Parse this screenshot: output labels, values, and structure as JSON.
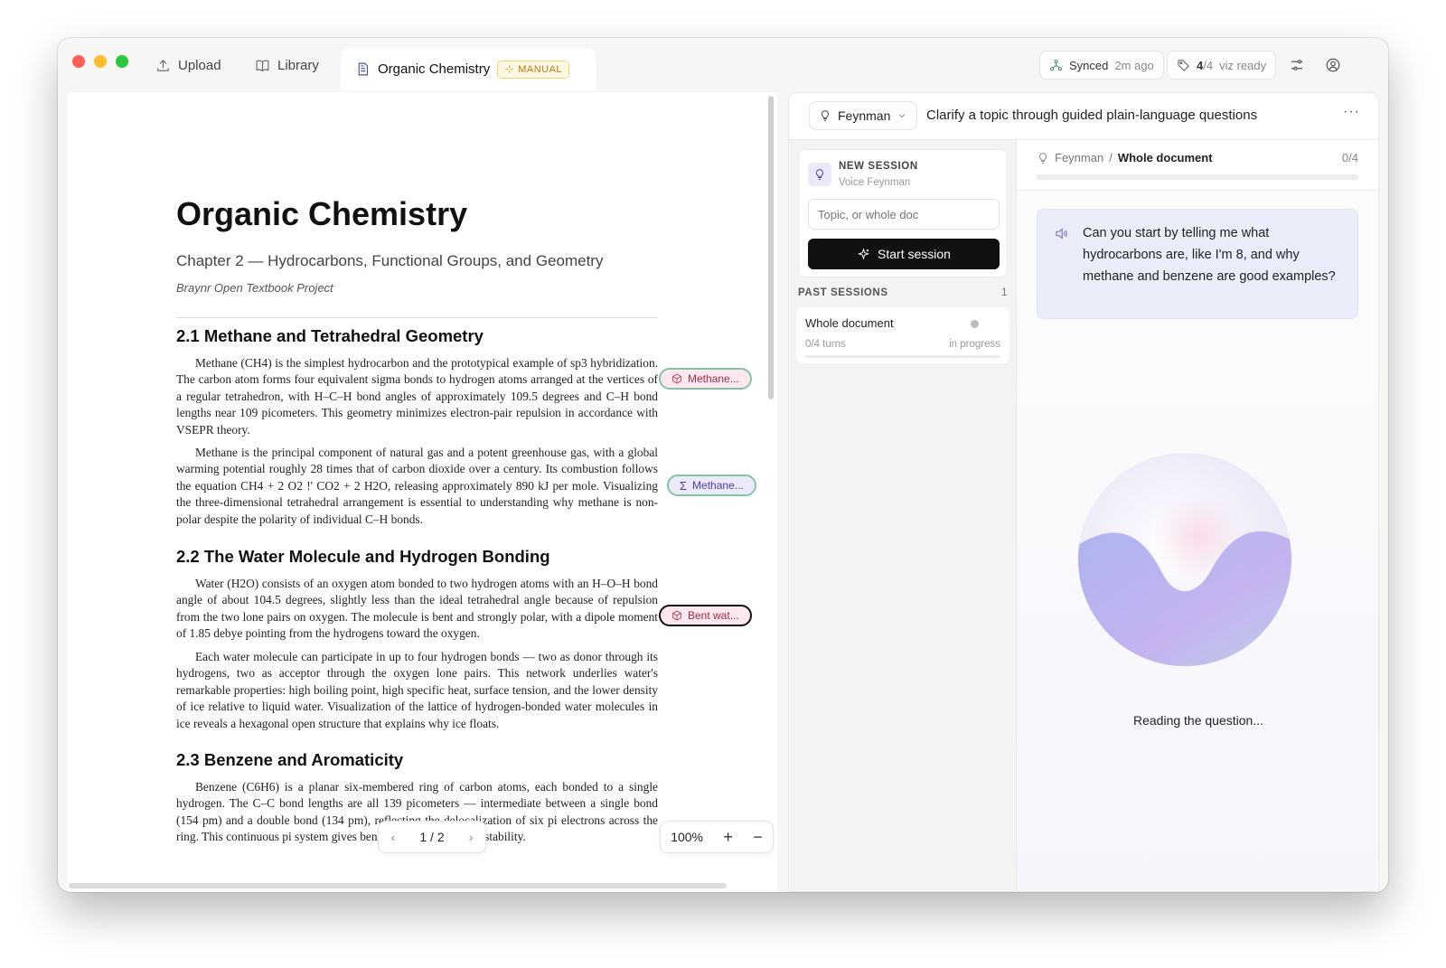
{
  "tabs": {
    "upload": "Upload",
    "library": "Library",
    "active": "Organic Chemistry",
    "active_badge": "MANUAL"
  },
  "status": {
    "sync_label": "Synced",
    "sync_time": "2m ago",
    "viz_count": "4",
    "viz_total": "/4",
    "viz_label": "viz ready"
  },
  "document": {
    "title": "Organic Chemistry",
    "chapter": "Chapter 2 — Hydrocarbons, Functional Groups, and Geometry",
    "publisher": "Braynr Open Textbook Project",
    "sections": [
      {
        "heading": "2.1  Methane and Tetrahedral Geometry",
        "paragraphs": [
          "Methane (CH4) is the simplest hydrocarbon and the prototypical example of sp3 hybridization. The carbon atom forms four equivalent sigma bonds to hydrogen atoms arranged at the vertices of a regular tetrahedron, with H–C–H bond angles of approximately 109.5 degrees and C–H bond lengths near 109 picometers. This geometry minimizes electron-pair repulsion in accordance with VSEPR theory.",
          "Methane is the principal component of natural gas and a potent greenhouse gas, with a global warming potential roughly 28 times that of carbon dioxide over a century. Its combustion follows the equation CH4 + 2 O2 !' CO2 + 2 H2O, releasing approximately 890 kJ per mole. Visualizing the three-dimensional tetrahedral arrangement is essential to understanding why methane is non-polar despite the polarity of individual C–H bonds."
        ]
      },
      {
        "heading": "2.2  The Water Molecule and Hydrogen Bonding",
        "paragraphs": [
          "Water (H2O) consists of an oxygen atom bonded to two hydrogen atoms with an H–O–H bond angle of about 104.5 degrees, slightly less than the ideal tetrahedral angle because of repulsion from the two lone pairs on oxygen. The molecule is bent and strongly polar, with a dipole moment of 1.85 debye pointing from the hydrogens toward the oxygen.",
          "Each water molecule can participate in up to four hydrogen bonds — two as donor through its hydrogens, two as acceptor through the oxygen lone pairs. This network underlies water's remarkable properties: high boiling point, high specific heat, surface tension, and the lower density of ice relative to liquid water. Visualization of the lattice of hydrogen-bonded water molecules in ice reveals a hexagonal open structure that explains why ice floats."
        ]
      },
      {
        "heading": "2.3  Benzene and Aromaticity",
        "paragraphs": [
          "Benzene (C6H6) is a planar six-membered ring of carbon atoms, each bonded to a single hydrogen. The C–C bond lengths are all 139 picometers — intermediate between a single bond (154 pm) and a double bond (134 pm), reflecting the delocalization of six pi electrons across the ring. This continuous pi system gives benzene its characteristic stability."
        ]
      }
    ],
    "annotations": [
      "Methane...",
      "Methane...",
      "Bent wat..."
    ]
  },
  "pager": {
    "current": "1 / 2",
    "prev": "‹",
    "next": "›"
  },
  "zoom": {
    "level": "100%",
    "plus": "+",
    "minus": "−"
  },
  "assistant": {
    "mode": "Feynman",
    "description": "Clarify a topic through guided plain-language questions",
    "more": "···"
  },
  "new_session": {
    "title": "NEW SESSION",
    "subtitle": "Voice Feynman",
    "placeholder": "Topic, or whole doc",
    "button": "Start session"
  },
  "past_sessions": {
    "heading": "PAST SESSIONS",
    "count": "1",
    "items": [
      {
        "title": "Whole document",
        "turns": "0/4 turns",
        "status": "in progress",
        "progress": 0
      }
    ]
  },
  "chat": {
    "crumb_mode": "Feynman",
    "crumb_sep": "/",
    "crumb_scope": "Whole document",
    "turns": "0/4",
    "progress": 0,
    "question": "Can you start by telling me what hydrocarbons are, like I'm 8, and why methane and benzene are good examples?",
    "orb_status": "Reading the question..."
  },
  "colors": {
    "accent": "#111111",
    "question_bg": "#ecedfb",
    "annotation_molecule": "#fce8ee",
    "annotation_equation": "#ece9fb",
    "manual_badge": "#b7791f"
  },
  "icons": {
    "upload": "upload-icon",
    "library": "book-icon",
    "document": "document-icon",
    "sync": "sync-icon",
    "viz": "tag-icon",
    "settings": "sliders-icon",
    "account": "user-circle-icon",
    "mode": "lightbulb-icon",
    "speaker": "speaker-icon",
    "sparkle": "sparkle-icon",
    "molecule": "cube-icon",
    "sigma": "sigma-icon"
  }
}
